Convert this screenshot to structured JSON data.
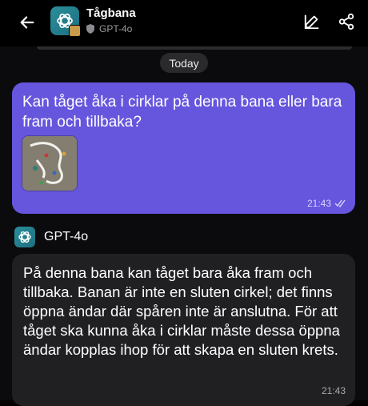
{
  "header": {
    "title": "Tågbana",
    "model": "GPT-4o",
    "back_icon": "arrow-left-icon",
    "edit_icon": "edit-icon",
    "share_icon": "share-icon"
  },
  "chat": {
    "date_label": "Today",
    "user_message": {
      "text": "Kan tåget åka i cirklar på denna bana eller bara fram och tillbaka?",
      "time": "21:43",
      "status_icon": "double-check-icon"
    },
    "bot": {
      "name": "GPT-4o",
      "text": "På denna bana kan tåget bara åka fram och tillbaka. Banan är inte en sluten cirkel; det finns öppna ändar där spåren inte är anslutna. För att tåget ska kunna åka i cirklar måste dessa öppna ändar kopplas ihop för att skapa en sluten krets.",
      "time": "21:43"
    }
  },
  "colors": {
    "background": "#000000",
    "user_bubble": "#6655dd",
    "bot_bubble": "#202023",
    "chip": "#2a2a2d"
  }
}
